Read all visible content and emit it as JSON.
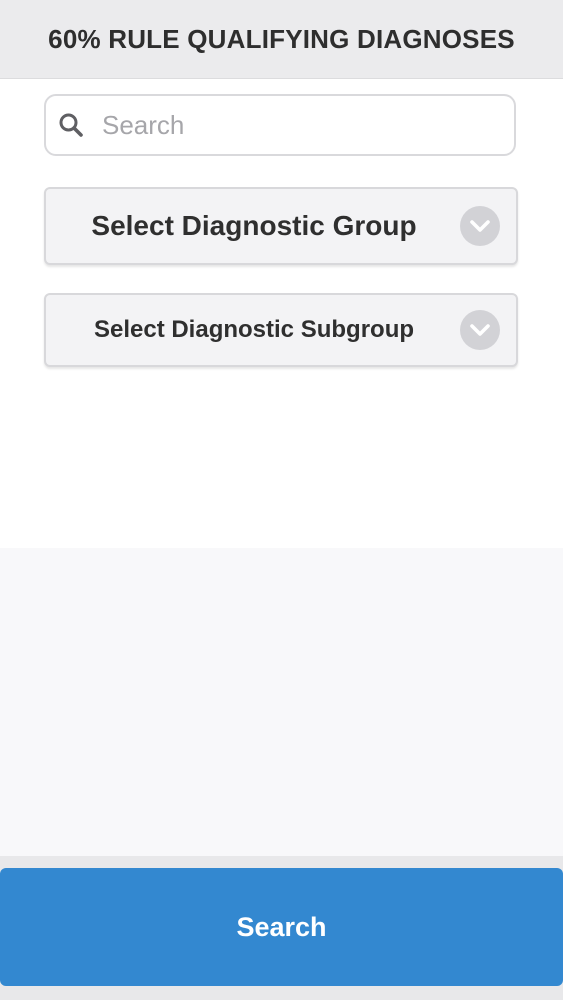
{
  "header": {
    "title": "60% RULE QUALIFYING DIAGNOSES"
  },
  "search": {
    "value": "",
    "placeholder": "Search",
    "icon": "search-icon"
  },
  "selects": {
    "group_label": "Select Diagnostic Group",
    "subgroup_label": "Select Diagnostic Subgroup",
    "icon": "chevron-down-icon"
  },
  "footer": {
    "search_button_label": "Search"
  },
  "colors": {
    "accent": "#3388d0",
    "header_bg": "#ebebed",
    "select_bg": "#f3f3f5"
  }
}
